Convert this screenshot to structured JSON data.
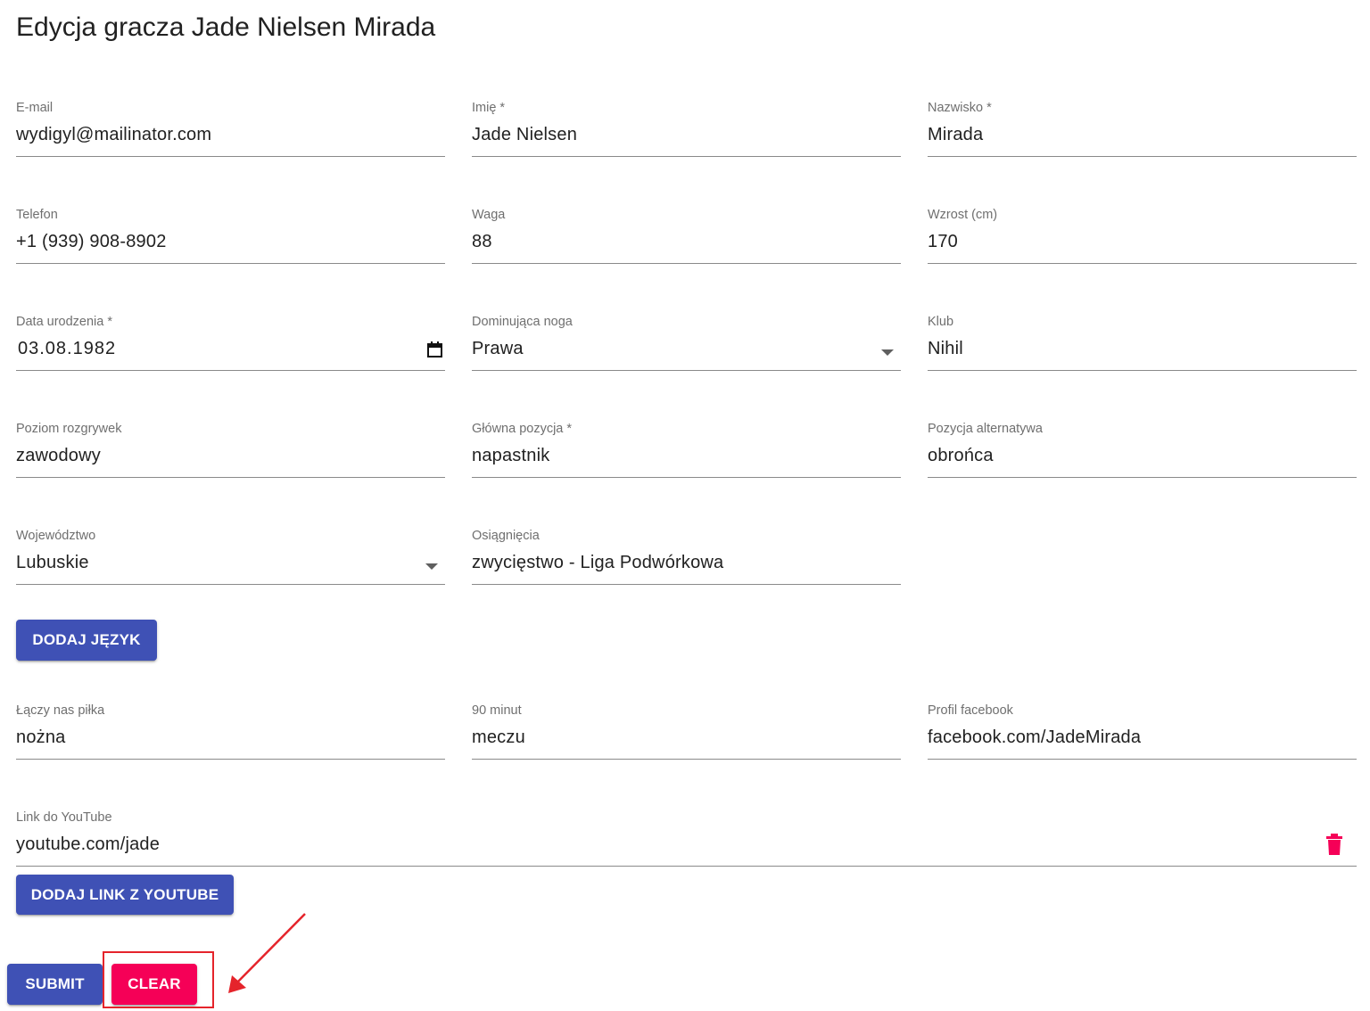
{
  "page": {
    "title": "Edycja gracza Jade Nielsen Mirada"
  },
  "fields": {
    "email": {
      "label": "E-mail",
      "value": "wydigyl@mailinator.com"
    },
    "first_name": {
      "label": "Imię *",
      "value": "Jade Nielsen"
    },
    "last_name": {
      "label": "Nazwisko *",
      "value": "Mirada"
    },
    "phone": {
      "label": "Telefon",
      "value": "+1 (939) 908-8902"
    },
    "weight": {
      "label": "Waga",
      "value": "88"
    },
    "height": {
      "label": "Wzrost (cm)",
      "value": "170"
    },
    "birth_date": {
      "label": "Data urodzenia *",
      "value": "03.08.1982"
    },
    "dominant_foot": {
      "label": "Dominująca noga",
      "value": "Prawa"
    },
    "club": {
      "label": "Klub",
      "value": "Nihil"
    },
    "league_level": {
      "label": "Poziom rozgrywek",
      "value": "zawodowy"
    },
    "main_position": {
      "label": "Główna pozycja *",
      "value": "napastnik"
    },
    "alt_position": {
      "label": "Pozycja alternatywa",
      "value": "obrońca"
    },
    "voivodeship": {
      "label": "Województwo",
      "value": "Lubuskie"
    },
    "achievements": {
      "label": "Osiągnięcia",
      "value": "zwycięstwo - Liga Podwórkowa"
    },
    "laczy_nas_pilka": {
      "label": "Łączy nas piłka",
      "value": "nożna"
    },
    "minut_90": {
      "label": "90 minut",
      "value": "meczu"
    },
    "facebook": {
      "label": "Profil facebook",
      "value": "facebook.com/JadeMirada"
    },
    "youtube": {
      "label": "Link do YouTube",
      "value": "youtube.com/jade"
    }
  },
  "buttons": {
    "add_language": "Dodaj język",
    "add_youtube": "Dodaj link z YouTube",
    "submit": "Submit",
    "clear": "Clear"
  },
  "icons": {
    "date_picker": "calendar-icon",
    "select_caret": "arrow-drop-down-icon",
    "delete_youtube": "trash-icon"
  },
  "colors": {
    "primary": "#3f51b5",
    "secondary": "#f50057",
    "annotation": "#e5242b"
  }
}
